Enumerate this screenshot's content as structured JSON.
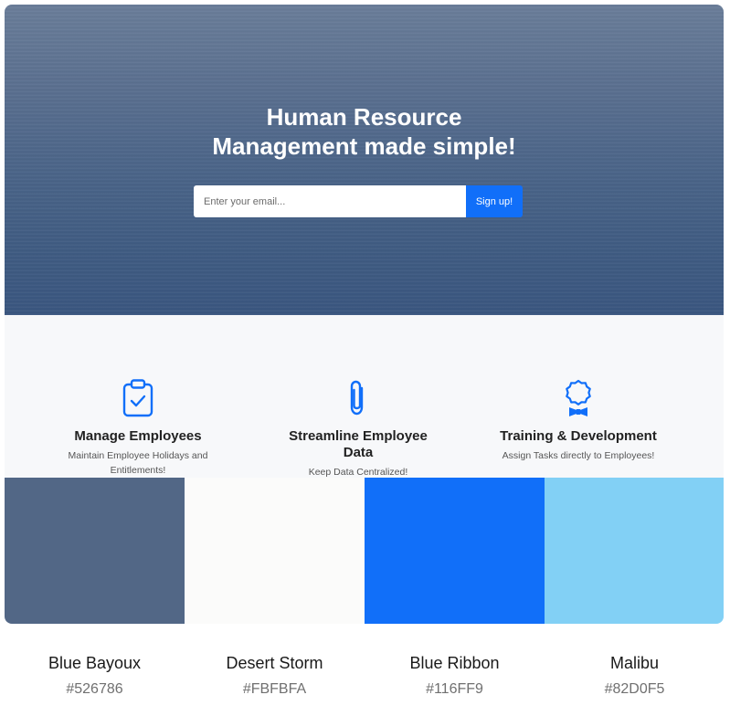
{
  "hero": {
    "title_line1": "Human Resource",
    "title_line2": "Management made simple!",
    "email_placeholder": "Enter your email...",
    "signup_label": "Sign up!"
  },
  "features": [
    {
      "icon": "clipboard-check-icon",
      "title": "Manage Employees",
      "description_line1": "Maintain Employee Holidays and",
      "description_line2": "Entitlements!"
    },
    {
      "icon": "paperclip-icon",
      "title_line1": "Streamline Employee",
      "title_line2": "Data",
      "description": "Keep Data Centralized!"
    },
    {
      "icon": "award-ribbon-icon",
      "title": "Training & Development",
      "description": "Assign Tasks directly to Employees!"
    }
  ],
  "palette": [
    {
      "name": "Blue Bayoux",
      "hex": "#526786"
    },
    {
      "name": "Desert Storm",
      "hex": "#FBFBFA"
    },
    {
      "name": "Blue Ribbon",
      "hex": "#116FF9"
    },
    {
      "name": "Malibu",
      "hex": "#82D0F5"
    }
  ],
  "colors": {
    "accent": "#116FF9",
    "icon": "#116FF9"
  }
}
